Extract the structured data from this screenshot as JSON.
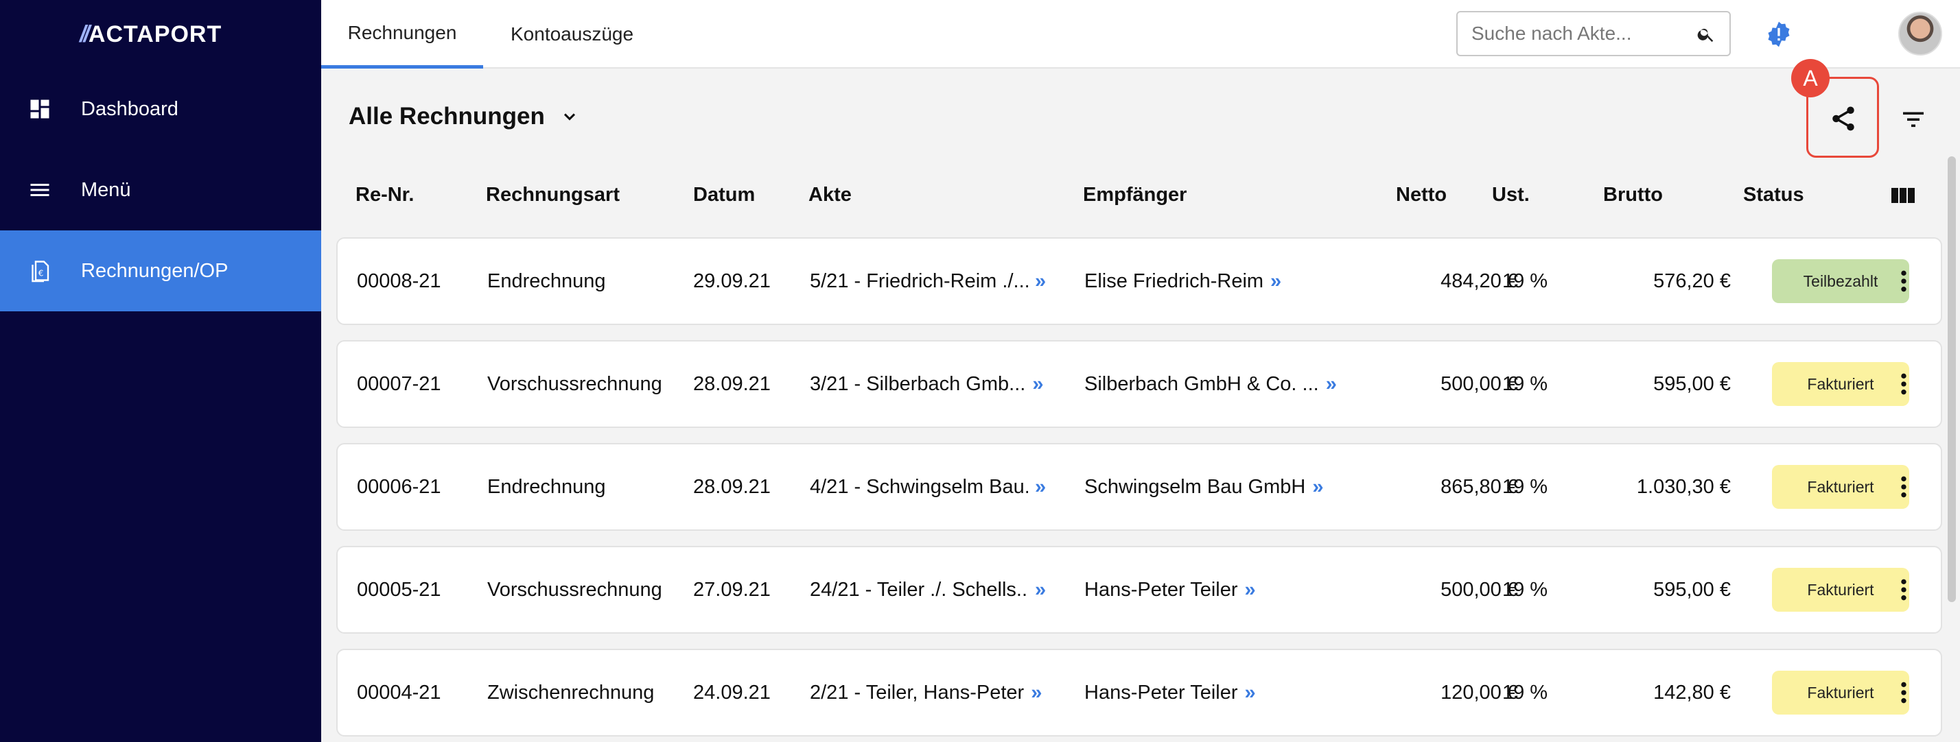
{
  "brand": {
    "slashes": "//",
    "name": "ACTAPORT"
  },
  "sidebar": {
    "items": [
      {
        "label": "Dashboard",
        "icon": "dashboard-icon"
      },
      {
        "label": "Menü",
        "icon": "menu-icon"
      },
      {
        "label": "Rechnungen/OP",
        "icon": "invoice-icon",
        "active": true
      }
    ]
  },
  "topbar": {
    "tabs": [
      {
        "label": "Rechnungen",
        "active": true
      },
      {
        "label": "Kontoauszüge",
        "active": false
      }
    ],
    "search": {
      "placeholder": "Suche nach Akte..."
    }
  },
  "header": {
    "view_title": "Alle Rechnungen",
    "marker_label": "A"
  },
  "table": {
    "columns": [
      "Re-Nr.",
      "Rechnungsart",
      "Datum",
      "Akte",
      "Empfänger",
      "Netto",
      "Ust.",
      "Brutto",
      "Status"
    ],
    "link_glyph": "»",
    "rows": [
      {
        "nr": "00008-21",
        "art": "Endrechnung",
        "datum": "29.09.21",
        "akte": "5/21 - Friedrich-Reim ./....",
        "empfaenger": "Elise Friedrich-Reim",
        "netto": "484,20 €",
        "ust": "19 %",
        "brutto": "576,20 €",
        "status": "Teilbezahlt"
      },
      {
        "nr": "00007-21",
        "art": "Vorschussrechnung",
        "datum": "28.09.21",
        "akte": "3/21 - Silberbach Gmb...",
        "empfaenger": "Silberbach GmbH & Co. ...",
        "netto": "500,00 €",
        "ust": "19 %",
        "brutto": "595,00 €",
        "status": "Fakturiert"
      },
      {
        "nr": "00006-21",
        "art": "Endrechnung",
        "datum": "28.09.21",
        "akte": "4/21 - Schwingselm Bau...",
        "empfaenger": "Schwingselm Bau GmbH",
        "netto": "865,80 €",
        "ust": "19 %",
        "brutto": "1.030,30 €",
        "status": "Fakturiert"
      },
      {
        "nr": "00005-21",
        "art": "Vorschussrechnung",
        "datum": "27.09.21",
        "akte": "24/21 - Teiler ./. Schells...",
        "empfaenger": "Hans-Peter Teiler",
        "netto": "500,00 €",
        "ust": "19 %",
        "brutto": "595,00 €",
        "status": "Fakturiert"
      },
      {
        "nr": "00004-21",
        "art": "Zwischenrechnung",
        "datum": "24.09.21",
        "akte": "2/21 - Teiler, Hans-Peter",
        "empfaenger": "Hans-Peter Teiler",
        "netto": "120,00 €",
        "ust": "19 %",
        "brutto": "142,80 €",
        "status": "Fakturiert"
      }
    ]
  },
  "colors": {
    "sidebar_bg": "#07063b",
    "accent": "#3a7be0",
    "status_teilbezahlt": "#c6e0a8",
    "status_fakturiert": "#fbf2a0",
    "highlight": "#e8483a"
  }
}
